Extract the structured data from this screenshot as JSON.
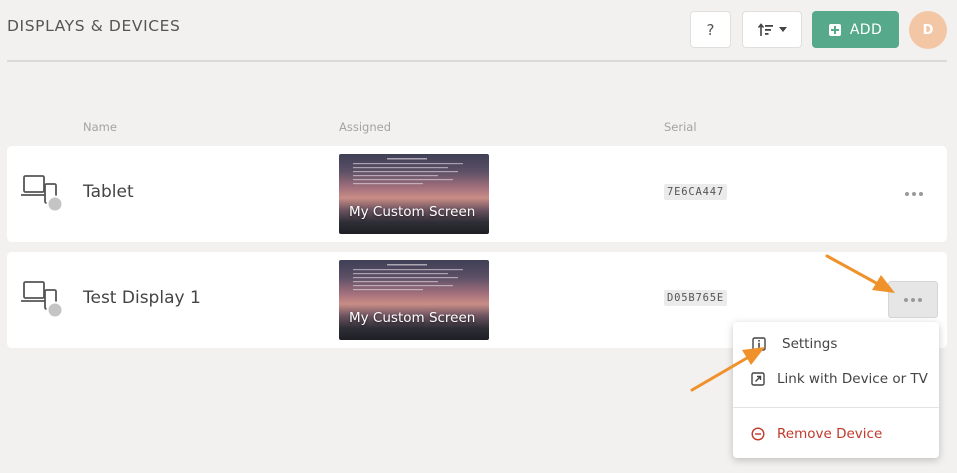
{
  "header": {
    "title": "DISPLAYS & DEVICES",
    "help_label": "?",
    "add_label": "ADD",
    "avatar_initial": "D"
  },
  "table": {
    "columns": [
      "Name",
      "Assigned",
      "Serial"
    ],
    "rows": [
      {
        "name": "Tablet",
        "assigned": "My Custom Screen",
        "serial": "7E6CA447"
      },
      {
        "name": "Test Display 1",
        "assigned": "My Custom Screen",
        "serial": "D05B765E"
      }
    ]
  },
  "menu": {
    "items": [
      "Settings",
      "Link with Device or TV",
      "Remove Device"
    ]
  },
  "colors": {
    "accent": "#56a98a",
    "avatar": "#f3c6a5",
    "danger": "#c0392b",
    "annotation_arrow": "#f0922b"
  }
}
